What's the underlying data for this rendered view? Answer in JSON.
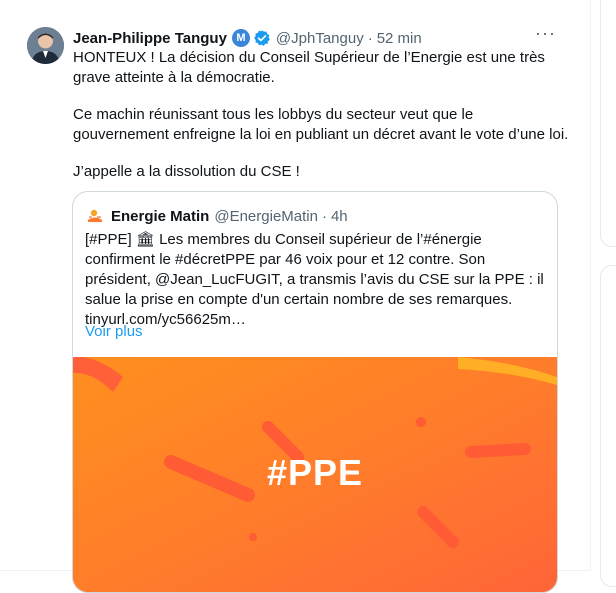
{
  "tweet": {
    "author_name": "Jean-Philippe Tanguy",
    "badge_letter": "M",
    "handle": "@JphTanguy",
    "separator": "·",
    "time": "52 min",
    "more_icon": "···",
    "paragraph1": "HONTEUX ! La décision du Conseil Supérieur de l’Energie est une très grave atteinte à la démocratie.",
    "paragraph2": "Ce machin réunissant tous les lobbys du secteur veut que le gouvernement enfreigne la loi en publiant un décret avant le vote d’une loi.",
    "paragraph3": "J’appelle a la dissolution du CSE !"
  },
  "quote": {
    "author_name": "Energie Matin",
    "handle": "@EnergieMatin",
    "separator": "·",
    "time": "4h",
    "text": "[#PPE] 🏛 Les membres du Conseil supérieur de l’#énergie confirment le #décretPPE par 46 voix pour et 12 contre. Son président, @Jean_LucFUGIT, a transmis l’avis du CSE sur la PPE : il salue la prise en compte d'un certain nombre de ses remarques.",
    "link": "tinyurl.com/yc56625m…",
    "see_more": "Voir plus",
    "media_title": "#PPE"
  },
  "colors": {
    "text": "#0f1419",
    "muted": "#536471",
    "accent": "#1d9bf0",
    "verified": "#1d9bf0",
    "media_orange": "#ff7a2e"
  }
}
